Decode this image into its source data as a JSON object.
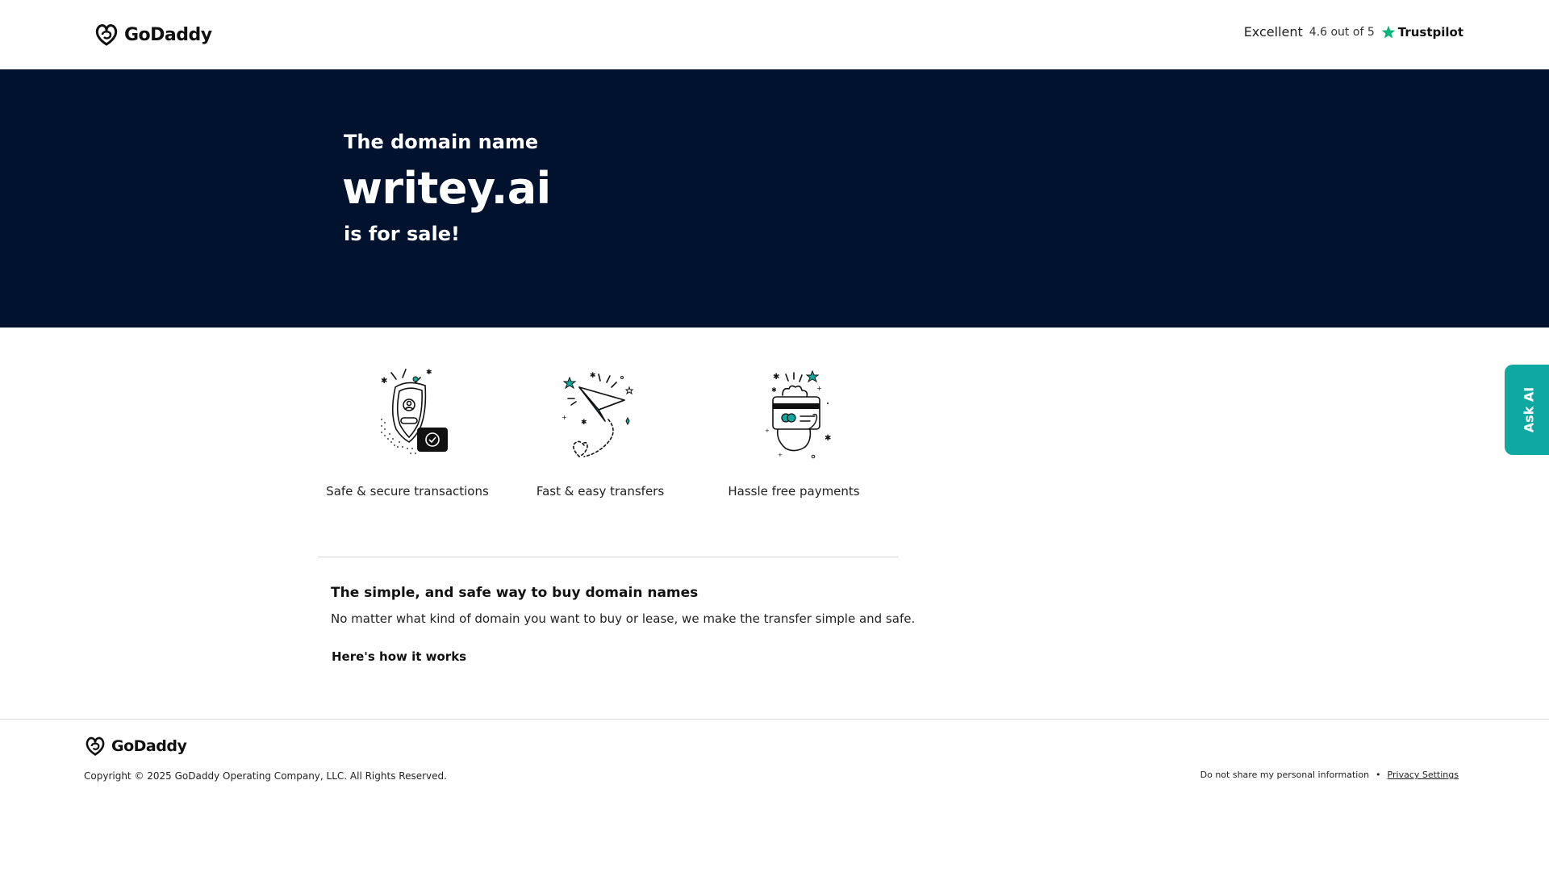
{
  "header": {
    "logo_text": "GoDaddy",
    "trustpilot": {
      "label": "Excellent",
      "rating": "4.6 out of 5",
      "brand": "Trustpilot"
    }
  },
  "hero": {
    "line1": "The domain name",
    "domain": "writey.ai",
    "line3": "is for sale!"
  },
  "features": [
    {
      "icon": "shield-user-check-icon",
      "label": "Safe & secure transactions"
    },
    {
      "icon": "paper-plane-icon",
      "label": "Fast & easy transfers"
    },
    {
      "icon": "hand-credit-card-icon",
      "label": "Hassle free payments"
    }
  ],
  "info": {
    "title": "The simple, and safe way to buy domain names",
    "text": "No matter what kind of domain you want to buy or lease, we make the transfer simple and safe.",
    "link": "Here's how it works"
  },
  "ask_ai": "Ask AI",
  "footer": {
    "logo_text": "GoDaddy",
    "copyright": "Copyright © 2025 GoDaddy Operating Company, LLC. All Rights Reserved.",
    "do_not_share": "Do not share my personal information",
    "separator": "•",
    "privacy": "Privacy Settings"
  },
  "colors": {
    "hero_bg": "#00122e",
    "accent_teal": "#10a9a2",
    "trustpilot_green": "#00b67a"
  }
}
